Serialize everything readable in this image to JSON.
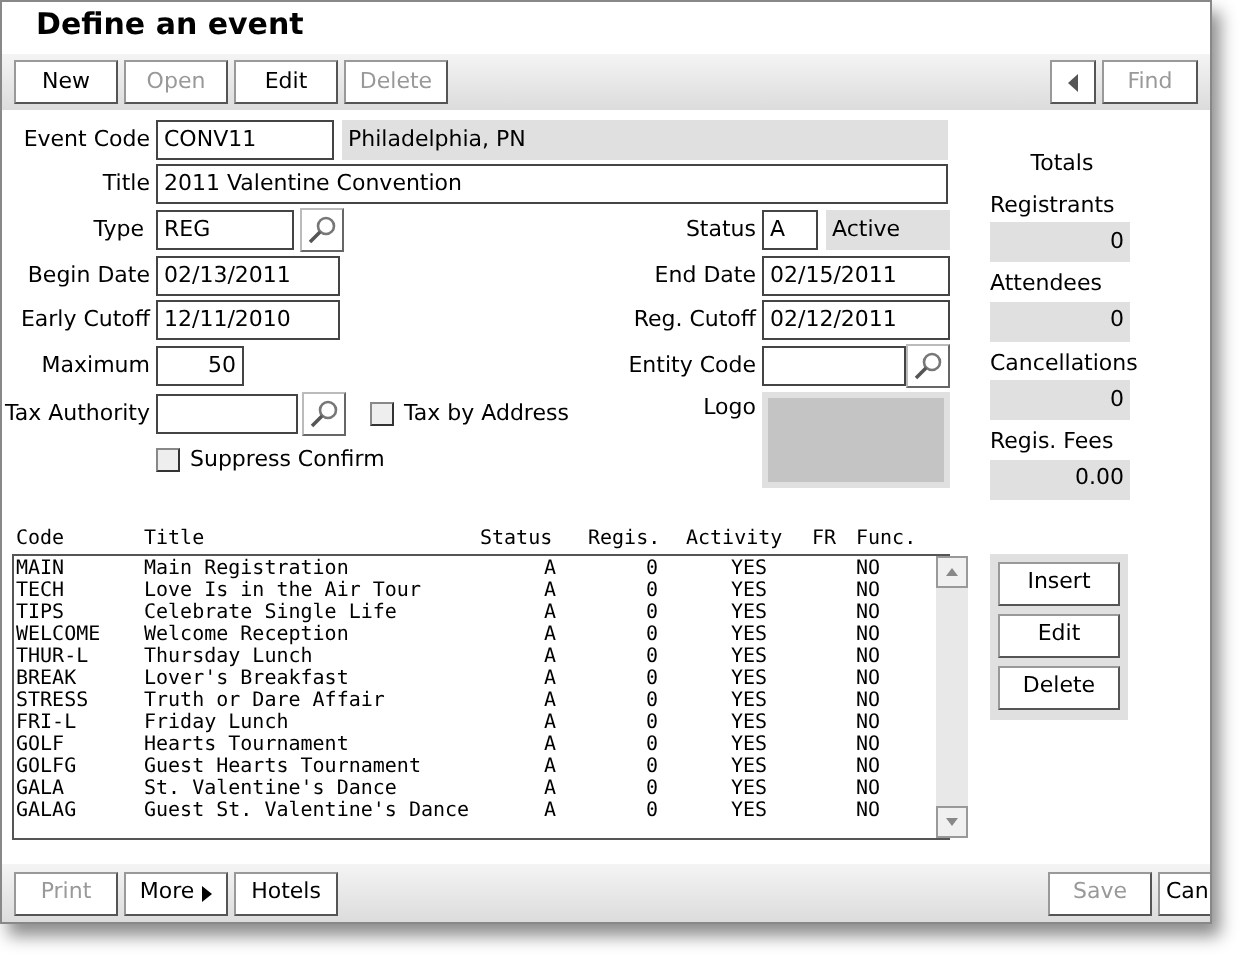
{
  "window": {
    "title": "Define an event"
  },
  "toolbar": {
    "left": [
      {
        "label": "New",
        "disabled": false
      },
      {
        "label": "Open",
        "disabled": true
      },
      {
        "label": "Edit",
        "disabled": false
      },
      {
        "label": "Delete",
        "disabled": true
      }
    ],
    "right": [
      {
        "label": "Find",
        "disabled": true
      }
    ]
  },
  "form": {
    "event_code": {
      "label": "Event Code",
      "value": "CONV11",
      "location": "Philadelphia, PN"
    },
    "title": {
      "label": "Title",
      "value": "2011 Valentine Convention"
    },
    "type": {
      "label": "Type",
      "value": "REG"
    },
    "status": {
      "label": "Status",
      "value": "A",
      "description": "Active"
    },
    "begin_date": {
      "label": "Begin Date",
      "value": "02/13/2011"
    },
    "end_date": {
      "label": "End Date",
      "value": "02/15/2011"
    },
    "early_cutoff": {
      "label": "Early Cutoff",
      "value": "12/11/2010"
    },
    "reg_cutoff": {
      "label": "Reg. Cutoff",
      "value": "02/12/2011"
    },
    "maximum": {
      "label": "Maximum",
      "value": "50"
    },
    "entity_code": {
      "label": "Entity Code"
    },
    "tax_authority": {
      "label": "Tax Authority"
    },
    "tax_by_address": {
      "label": "Tax by Address",
      "checked": false
    },
    "suppress_confirm": {
      "label": "Suppress Confirm",
      "checked": false
    },
    "logo": {
      "label": "Logo"
    }
  },
  "totals": {
    "title": "Totals",
    "items": [
      {
        "label": "Registrants",
        "value": "0"
      },
      {
        "label": "Attendees",
        "value": "0"
      },
      {
        "label": "Cancellations",
        "value": "0"
      },
      {
        "label": "Regis. Fees",
        "value": "0.00"
      }
    ]
  },
  "table": {
    "columns": [
      "Code",
      "Title",
      "Status",
      "Regis.",
      "Activity",
      "FR",
      "Func."
    ],
    "rows": [
      [
        "MAIN",
        "Main Registration",
        "A",
        "0",
        "YES",
        "",
        "NO"
      ],
      [
        "TECH",
        "Love Is in the Air Tour",
        "A",
        "0",
        "YES",
        "",
        "NO"
      ],
      [
        "TIPS",
        "Celebrate Single Life",
        "A",
        "0",
        "YES",
        "",
        "NO"
      ],
      [
        "WELCOME",
        "Welcome Reception",
        "A",
        "0",
        "YES",
        "",
        "NO"
      ],
      [
        "THUR-L",
        "Thursday Lunch",
        "A",
        "0",
        "YES",
        "",
        "NO"
      ],
      [
        "BREAK",
        "Lover's Breakfast",
        "A",
        "0",
        "YES",
        "",
        "NO"
      ],
      [
        "STRESS",
        "Truth or Dare Affair",
        "A",
        "0",
        "YES",
        "",
        "NO"
      ],
      [
        "FRI-L",
        "Friday Lunch",
        "A",
        "0",
        "YES",
        "",
        "NO"
      ],
      [
        "GOLF",
        "Hearts Tournament",
        "A",
        "0",
        "YES",
        "",
        "NO"
      ],
      [
        "GOLFG",
        "Guest Hearts Tournament",
        "A",
        "0",
        "YES",
        "",
        "NO"
      ],
      [
        "GALA",
        "St. Valentine's Dance",
        "A",
        "0",
        "YES",
        "",
        "NO"
      ],
      [
        "GALAG",
        "Guest St. Valentine's Dance",
        "A",
        "0",
        "YES",
        "",
        "NO"
      ]
    ]
  },
  "list_buttons": [
    "Insert",
    "Edit",
    "Delete"
  ],
  "bottom_bar": {
    "left": [
      {
        "label": "Print",
        "disabled": true,
        "kind": "plain"
      },
      {
        "label": "More",
        "disabled": false,
        "kind": "menu"
      },
      {
        "label": "Hotels",
        "disabled": false,
        "kind": "plain"
      }
    ],
    "right": [
      {
        "label": "Save",
        "disabled": true
      },
      {
        "label": "Can",
        "disabled": false
      }
    ]
  }
}
